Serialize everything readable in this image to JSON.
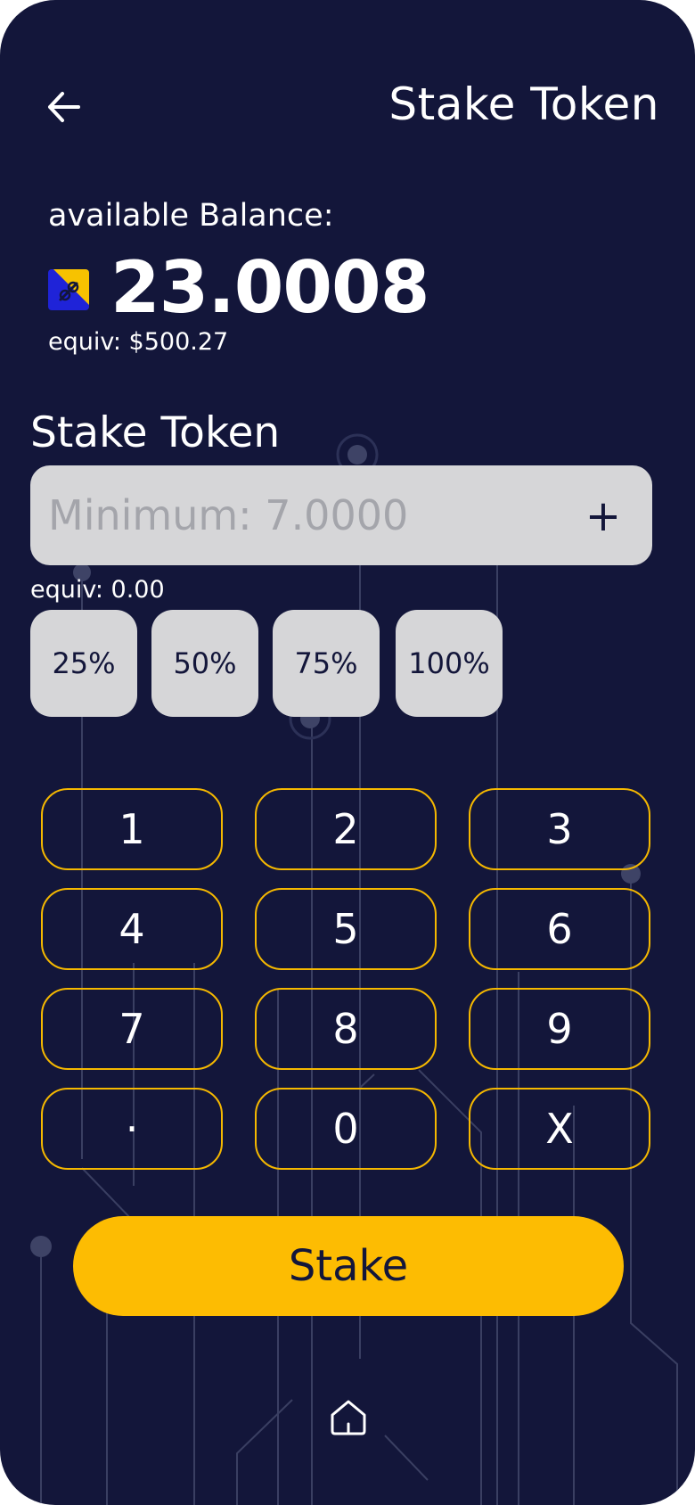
{
  "header": {
    "title": "Stake Token",
    "back_icon": "arrow-left-icon"
  },
  "balance": {
    "label": "available Balance:",
    "value": "23.0008",
    "equiv": "equiv: $500.27",
    "token_icon": "token-logo-icon"
  },
  "stake_form": {
    "title": "Stake Token",
    "amount_value": "",
    "amount_placeholder": "Minimum: 7.0000",
    "plus_label": "+",
    "equiv": "equiv: 0.00",
    "percent_options": [
      "25%",
      "50%",
      "75%",
      "100%"
    ]
  },
  "keypad": {
    "keys": [
      "1",
      "2",
      "3",
      "4",
      "5",
      "6",
      "7",
      "8",
      "9",
      "·",
      "0",
      "X"
    ]
  },
  "actions": {
    "stake_label": "Stake"
  },
  "bottom_nav": {
    "home_icon": "home-icon"
  },
  "colors": {
    "background": "#13163a",
    "accent": "#fdbc02",
    "key_border": "#f5b800",
    "field_bg": "#d6d6d8",
    "placeholder": "#a4a5ab"
  }
}
